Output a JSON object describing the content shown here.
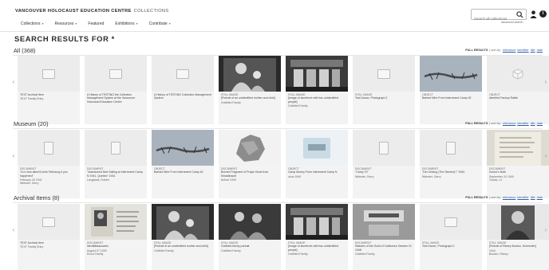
{
  "header": {
    "brand_bold": "VANCOUVER HOLOCAUST EDUCATION CENTRE",
    "brand_light": "COLLECTIONS",
    "nav": [
      {
        "label": "Collections",
        "has_menu": true
      },
      {
        "label": "Resources",
        "has_menu": true
      },
      {
        "label": "Featured",
        "has_menu": false
      },
      {
        "label": "Exhibitions",
        "has_menu": true
      },
      {
        "label": "Contribute",
        "has_menu": true
      }
    ],
    "search_placeholder": "Search all collections",
    "advanced_label": "advanced search",
    "info_glyph": "i"
  },
  "page_title": "SEARCH RESULTS FOR *",
  "sections": [
    {
      "heading": "All (368)",
      "meta": {
        "full": "FULL RESULTS",
        "sort": "| sort by:",
        "links": [
          "relevance",
          "identifier",
          "title",
          "date"
        ]
      },
      "cards": [
        {
          "thumb": "placeholder-image",
          "kind": "",
          "title": "TEXT Archival Item",
          "sub": "TEXT Family Entry"
        },
        {
          "thumb": "placeholder-image",
          "kind": "",
          "title": "A History of TESTING the Collection Management System at the Vancouver Holocaust Education Centre",
          "sub": ""
        },
        {
          "thumb": "placeholder-image",
          "kind": "",
          "title": "A History of TESTING Collection Management System",
          "sub": ""
        },
        {
          "thumb": "photo-portrait",
          "kind": "STILL IMAGE",
          "title": "[Portrait of an unidentified mother and child]",
          "sub": "Gottfried Family"
        },
        {
          "thumb": "photo-storefront",
          "kind": "STILL IMAGE",
          "title": "[Image of storefront with two unidentified people]",
          "sub": "Gottfried Family"
        },
        {
          "thumb": "placeholder-image",
          "kind": "STILL IMAGE",
          "title": "Test Dance, Photograph 2",
          "sub": ""
        },
        {
          "thumb": "photo-wire",
          "kind": "OBJECT",
          "title": "Barbed Wire From Internment Camp #2",
          "sub": ""
        },
        {
          "thumb": "placeholder-object",
          "kind": "OBJECT",
          "title": "Aberfeld Factory Rattle",
          "sub": ""
        }
      ]
    },
    {
      "heading": "Museum (20)",
      "meta": {
        "full": "FULL RESULTS",
        "sort": "| sort by:",
        "links": [
          "relevance",
          "identifier",
          "title",
          "date"
        ]
      },
      "cards": [
        {
          "thumb": "placeholder-document",
          "kind": "DOCUMENT",
          "title": "\"A rx new alien!/Comin Rehoung it you happened\"",
          "sub": "February 20 1941\nWebster, Gerry"
        },
        {
          "thumb": "placeholder-document",
          "kind": "DOCUMENT",
          "title": "\"Abandoned Bed Sailing at Internment Camp N 1941, Quebec\" 1941",
          "sub": "Langstadt, Robert"
        },
        {
          "thumb": "photo-wire",
          "kind": "OBJECT",
          "title": "Barbed Wire From Internment Camp #2",
          "sub": ""
        },
        {
          "thumb": "photo-bread",
          "kind": "DOCUMENT",
          "title": "Burned Fragment of Prayer Book from Kristallnacht",
          "sub": "before 1939"
        },
        {
          "thumb": "photo-tin",
          "kind": "OBJECT",
          "title": "Camp Money From Internment Camp N",
          "sub": "circa 1940"
        },
        {
          "thumb": "placeholder-document",
          "kind": "DOCUMENT",
          "title": "\"Camp 70\"",
          "sub": "Webster, Gerry"
        },
        {
          "thumb": "placeholder-document",
          "kind": "DOCUMENT",
          "title": "\"Der Untang (The Sinners)?\" 1940",
          "sub": "Webster, Gerry"
        },
        {
          "thumb": "photo-letter",
          "kind": "DOCUMENT",
          "title": "Doctor's Note",
          "sub": "September 24 1940\nTomas, LV"
        }
      ]
    },
    {
      "heading": "Archival Items (8)",
      "meta": {
        "full": "FULL RESULTS",
        "sort": "| sort by:",
        "links": [
          "relevance",
          "identifier",
          "title",
          "date"
        ]
      },
      "cards": [
        {
          "thumb": "placeholder-image",
          "kind": "",
          "title": "TEXT Archival Item",
          "sub": "TEXT Family Entry"
        },
        {
          "thumb": "photo-passport",
          "kind": "DOCUMENT",
          "title": "Identitätsausweis",
          "sub": "August 07 1939\nKrouz Family"
        },
        {
          "thumb": "photo-portrait",
          "kind": "STILL IMAGE",
          "title": "[Portrait of an unidentified mother and child]",
          "sub": "Gottfried Family"
        },
        {
          "thumb": "photo-portrait2",
          "kind": "STILL IMAGE",
          "title": "Gottfried family portrait",
          "sub": "Gottfried Family"
        },
        {
          "thumb": "photo-storefront",
          "kind": "STILL IMAGE",
          "title": "[Image of storefront with two unidentified people]",
          "sub": "Gottfried Family"
        },
        {
          "thumb": "photo-sign",
          "kind": "DOCUMENT",
          "title": "Statutes of the Guild of Craftsmen October 01 1948",
          "sub": "Gottfried Family"
        },
        {
          "thumb": "placeholder-image",
          "kind": "STILL IMAGE",
          "title": "Test Dance, Photograph 2",
          "sub": ""
        },
        {
          "thumb": "photo-portrait3",
          "kind": "STILL IMAGE",
          "title": "[Portrait of Rickey Burdun, Kulmhofer]",
          "sub": "1944\nBurdun, Rickey"
        }
      ]
    }
  ],
  "icons": {
    "search": "search-icon",
    "user": "user-icon",
    "info": "info-icon",
    "prev": "chevron-left-icon",
    "next": "chevron-right-icon"
  },
  "arrows": {
    "prev": "‹",
    "next": "›"
  }
}
